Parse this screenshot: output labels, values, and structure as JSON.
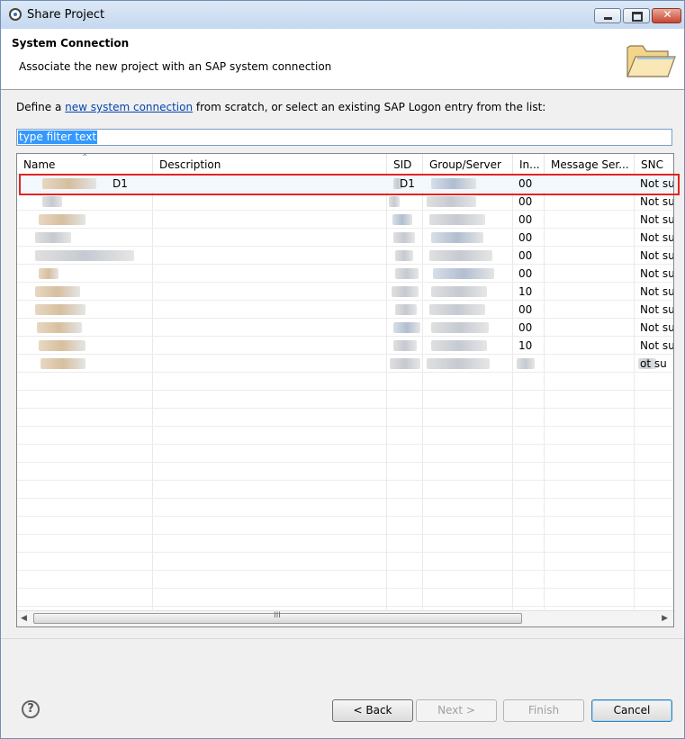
{
  "window": {
    "title": "Share Project",
    "controls": {
      "minimize": "minimize",
      "maximize": "maximize",
      "close": "✕"
    }
  },
  "header": {
    "title": "System Connection",
    "description": "Associate the new project with an SAP system connection",
    "icon": "folder-icon"
  },
  "instruction": {
    "prefix": "Define a ",
    "link": "new system connection",
    "suffix": " from scratch, or select an existing SAP Logon entry from the list:"
  },
  "filter": {
    "value": "type filter text"
  },
  "table": {
    "columns": [
      "Name",
      "Description",
      "SID",
      "Group/Server",
      "In...",
      "Message Ser...",
      "SNC"
    ],
    "rows": [
      {
        "name": "D1",
        "description": "",
        "sid": "D1",
        "group": "",
        "instance": "00",
        "message_server": "",
        "snc": "Not su"
      },
      {
        "name": "",
        "description": "",
        "sid": "",
        "group": "",
        "instance": "00",
        "message_server": "",
        "snc": "Not su"
      },
      {
        "name": "",
        "description": "",
        "sid": "",
        "group": "",
        "instance": "00",
        "message_server": "",
        "snc": "Not su"
      },
      {
        "name": "",
        "description": "",
        "sid": "",
        "group": "",
        "instance": "00",
        "message_server": "",
        "snc": "Not su"
      },
      {
        "name": "",
        "description": "",
        "sid": "",
        "group": "",
        "instance": "00",
        "message_server": "",
        "snc": "Not su"
      },
      {
        "name": "",
        "description": "",
        "sid": "",
        "group": "",
        "instance": "00",
        "message_server": "",
        "snc": "Not su"
      },
      {
        "name": "",
        "description": "",
        "sid": "",
        "group": "",
        "instance": "10",
        "message_server": "",
        "snc": "Not su"
      },
      {
        "name": "",
        "description": "",
        "sid": "",
        "group": "",
        "instance": "00",
        "message_server": "",
        "snc": "Not su"
      },
      {
        "name": "",
        "description": "",
        "sid": "",
        "group": "",
        "instance": "00",
        "message_server": "",
        "snc": "Not su"
      },
      {
        "name": "",
        "description": "",
        "sid": "",
        "group": "",
        "instance": "10",
        "message_server": "",
        "snc": "Not su"
      },
      {
        "name": "",
        "description": "",
        "sid": "",
        "group": "",
        "instance": "",
        "message_server": "",
        "snc": "ot su"
      }
    ],
    "scrollbar_grip": "III"
  },
  "buttons": {
    "help": "?",
    "back": "< Back",
    "next": "Next >",
    "finish": "Finish",
    "cancel": "Cancel"
  },
  "colors": {
    "highlight_border": "#e02424",
    "link": "#0645ad",
    "selection": "#3399ff"
  }
}
